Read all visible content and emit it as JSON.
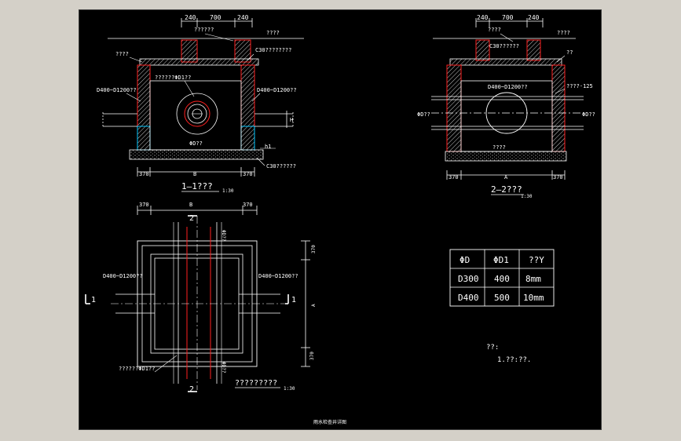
{
  "section_1_1": {
    "dims_top": [
      "240",
      "700",
      "240"
    ],
    "ground_label": "??????",
    "ground_label_right": "????",
    "cover_label": "????",
    "slab_label": "C30????????",
    "pipe_left": "D400~D1200??",
    "pipe_right": "D400~D1200??",
    "manhole_label": "??????ΦD1??",
    "phi_label": "ΦD??",
    "h1_label": "h1",
    "base_label": "C30??????",
    "dims_bottom": [
      "370",
      "B",
      "370"
    ],
    "h_label": "H",
    "title": "1—1???",
    "scale": "1:30"
  },
  "section_2_2": {
    "dims_top": [
      "240",
      "700",
      "240"
    ],
    "cover_label": "????",
    "slab_label": "C30??????",
    "right_label": "????",
    "right_small": "??",
    "pipe_label": "D400~D1200??",
    "side_label": "????·125",
    "phi_left": "ΦD??",
    "phi_right": "ΦD??",
    "bottom_label": "????",
    "dims_bottom": [
      "370",
      "A",
      "370"
    ],
    "title": "2—2???",
    "scale": "1:30"
  },
  "plan": {
    "dims_top": [
      "370",
      "B",
      "370"
    ],
    "pipe_left": "D400~D1200??",
    "pipe_right": "D400~D1200??",
    "cut_1": "1",
    "cut_2": "2",
    "dims_right": [
      "370",
      "A",
      "370"
    ],
    "right_top_label": "ΦD??",
    "right_bottom_label": "ΦD??",
    "manhole_label": "??????ΦD1??",
    "title": "?????????",
    "scale": "1:30"
  },
  "table": {
    "headers": [
      "ΦD",
      "ΦD1",
      "??Y"
    ],
    "rows": [
      [
        "D300",
        "400",
        "8mm"
      ],
      [
        "D400",
        "500",
        "10mm"
      ]
    ]
  },
  "notes": {
    "heading": "??:",
    "line": "1.??:??."
  },
  "sheet_title": "雨水检查井详图"
}
